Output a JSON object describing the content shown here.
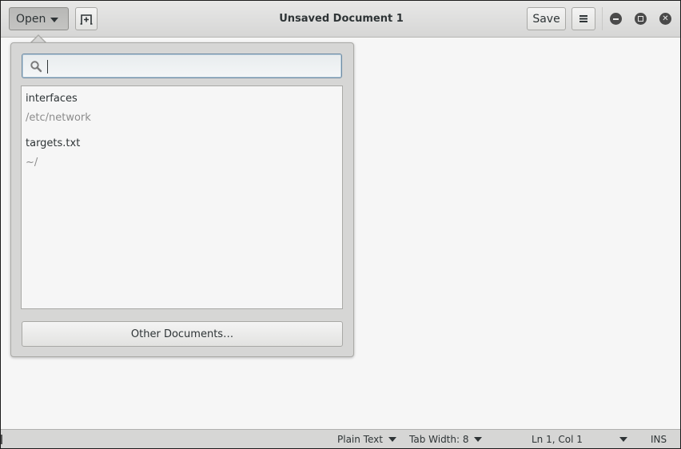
{
  "window": {
    "title": "Unsaved Document 1",
    "controls": {
      "minimize": "minimize-icon",
      "maximize": "maximize-icon",
      "close": "close-icon"
    }
  },
  "headerbar": {
    "open_label": "Open",
    "new_tab_icon": "new-tab-icon",
    "save_label": "Save",
    "menu_icon": "hamburger-menu-icon"
  },
  "open_popover": {
    "search": {
      "value": "",
      "placeholder": "",
      "icon": "search-icon"
    },
    "recent_documents": [
      {
        "name": "interfaces",
        "path": "/etc/network"
      },
      {
        "name": "targets.txt",
        "path": "~/"
      }
    ],
    "other_documents_label": "Other Documents…"
  },
  "statusbar": {
    "language": "Plain Text",
    "tab_width": "Tab Width: 8",
    "position": "Ln 1, Col 1",
    "mode": "INS"
  },
  "colors": {
    "headerbar_bg": "#dcdcdb",
    "focus_border": "#6e8ba3",
    "window_control": "#4a4a4a"
  }
}
